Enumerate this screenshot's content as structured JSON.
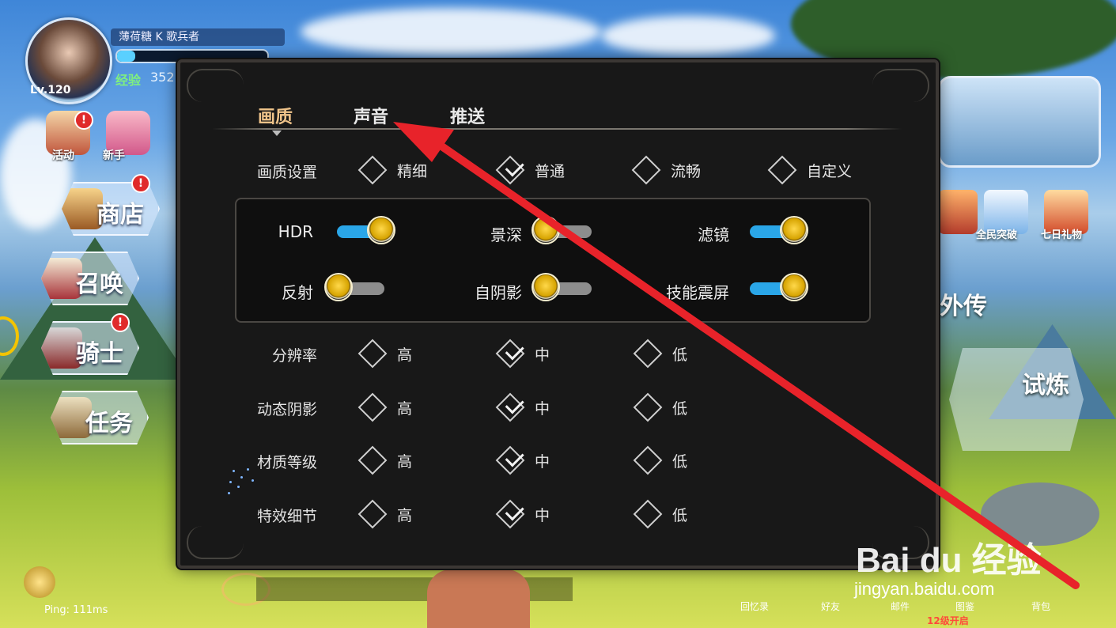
{
  "hud": {
    "player_name": "薄荷糖 K 歌兵者",
    "level": "Lv.120",
    "exp_label": "经验",
    "exp_value": "352",
    "exp_fraction": 0.12,
    "ping": "Ping: 111ms",
    "icon_labels": [
      "活动",
      "新手"
    ],
    "menu": [
      "商店",
      "召唤",
      "骑士",
      "任务"
    ],
    "right_labels": [
      "外传",
      "试炼",
      "全民突破",
      "七日礼物"
    ],
    "bottom_labels": [
      "回忆录",
      "好友",
      "邮件",
      "图鉴",
      "背包"
    ],
    "unlock_note": "12级开启"
  },
  "watermark": {
    "brand": "Bai du 经验",
    "url": "jingyan.baidu.com"
  },
  "settings": {
    "tabs": [
      {
        "label": "画质",
        "active": true
      },
      {
        "label": "声音",
        "active": false
      },
      {
        "label": "推送",
        "active": false
      }
    ],
    "quality": {
      "label": "画质设置",
      "options": [
        "精细",
        "普通",
        "流畅",
        "自定义"
      ],
      "selected": "普通"
    },
    "toggles": [
      {
        "label": "HDR",
        "on": true
      },
      {
        "label": "景深",
        "on": false
      },
      {
        "label": "滤镜",
        "on": true
      },
      {
        "label": "反射",
        "on": false
      },
      {
        "label": "自阴影",
        "on": false
      },
      {
        "label": "技能震屏",
        "on": true
      }
    ],
    "levels": [
      {
        "label": "分辨率",
        "options": [
          "高",
          "中",
          "低"
        ],
        "selected": "中"
      },
      {
        "label": "动态阴影",
        "options": [
          "高",
          "中",
          "低"
        ],
        "selected": "中"
      },
      {
        "label": "材质等级",
        "options": [
          "高",
          "中",
          "低"
        ],
        "selected": "中"
      },
      {
        "label": "特效细节",
        "options": [
          "高",
          "中",
          "低"
        ],
        "selected": "中"
      }
    ]
  },
  "annotation": {
    "arrow_color": "#e8232a"
  },
  "colors": {
    "tab_active": "#f0c48a",
    "toggle_on": "#2aa6e8",
    "toggle_off": "#8d8d8d",
    "knob": "#ffd84a"
  }
}
